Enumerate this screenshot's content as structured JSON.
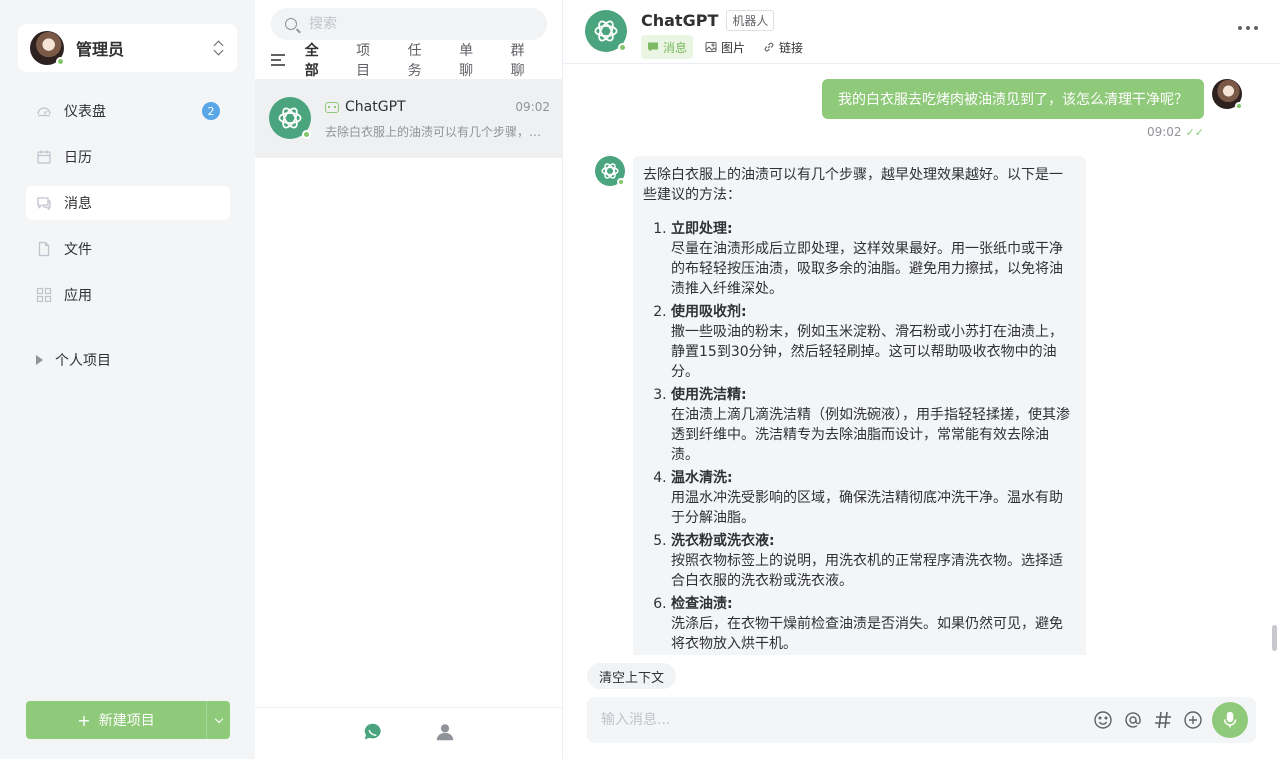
{
  "user": {
    "name": "管理员"
  },
  "nav": {
    "items": [
      {
        "label": "仪表盘",
        "badge": "2",
        "icon": "dashboard-icon"
      },
      {
        "label": "日历",
        "icon": "calendar-icon"
      },
      {
        "label": "消息",
        "icon": "message-icon",
        "active": true
      },
      {
        "label": "文件",
        "icon": "file-icon"
      },
      {
        "label": "应用",
        "icon": "apps-icon"
      }
    ],
    "project_group": "个人项目",
    "new_project": "新建项目"
  },
  "conversations": {
    "search_placeholder": "搜索",
    "tabs": [
      "全部",
      "项目",
      "任务",
      "单聊",
      "群聊"
    ],
    "active_tab": "全部",
    "items": [
      {
        "name": "ChatGPT",
        "time": "09:02",
        "preview": "去除白衣服上的油渍可以有几个步骤，越早处理效果越好。以下是一些建议的方法："
      }
    ]
  },
  "chat": {
    "title": "ChatGPT",
    "tag": "机器人",
    "tabs": [
      "消息",
      "图片",
      "链接"
    ],
    "active_tab": "消息",
    "outgoing": {
      "text": "我的白衣服去吃烤肉被油渍见到了，该怎么清理干净呢？",
      "time": "09:02"
    },
    "reply": {
      "intro": "去除白衣服上的油渍可以有几个步骤，越早处理效果越好。以下是一些建议的方法：",
      "steps": [
        {
          "title": "立即处理:",
          "text": "尽量在油渍形成后立即处理，这样效果最好。用一张纸巾或干净的布轻轻按压油渍，吸取多余的油脂。避免用力擦拭，以免将油渍推入纤维深处。"
        },
        {
          "title": "使用吸收剂:",
          "text": "撒一些吸油的粉末，例如玉米淀粉、滑石粉或小苏打在油渍上，静置15到30分钟，然后轻轻刷掉。这可以帮助吸收衣物中的油分。"
        },
        {
          "title": "使用洗洁精:",
          "text": "在油渍上滴几滴洗洁精（例如洗碗液），用手指轻轻揉搓，使其渗透到纤维中。洗洁精专为去除油脂而设计，常常能有效去除油渍。"
        },
        {
          "title": "温水清洗:",
          "text": "用温水冲洗受影响的区域，确保洗洁精彻底冲洗干净。温水有助于分解油脂。"
        },
        {
          "title": "洗衣粉或洗衣液:",
          "text": "按照衣物标签上的说明，用洗衣机的正常程序清洗衣物。选择适合白衣服的洗衣粉或洗衣液。"
        },
        {
          "title": "检查油渍:",
          "text": "洗涤后，在衣物干燥前检查油渍是否消失。如果仍然可见，避免将衣物放入烘干机。"
        }
      ]
    },
    "clear_context": "清空上下文",
    "input_placeholder": "输入消息..."
  },
  "colors": {
    "accent": "#8fc97a",
    "gpt": "#4aa57e",
    "badge": "#5aa7e8"
  }
}
